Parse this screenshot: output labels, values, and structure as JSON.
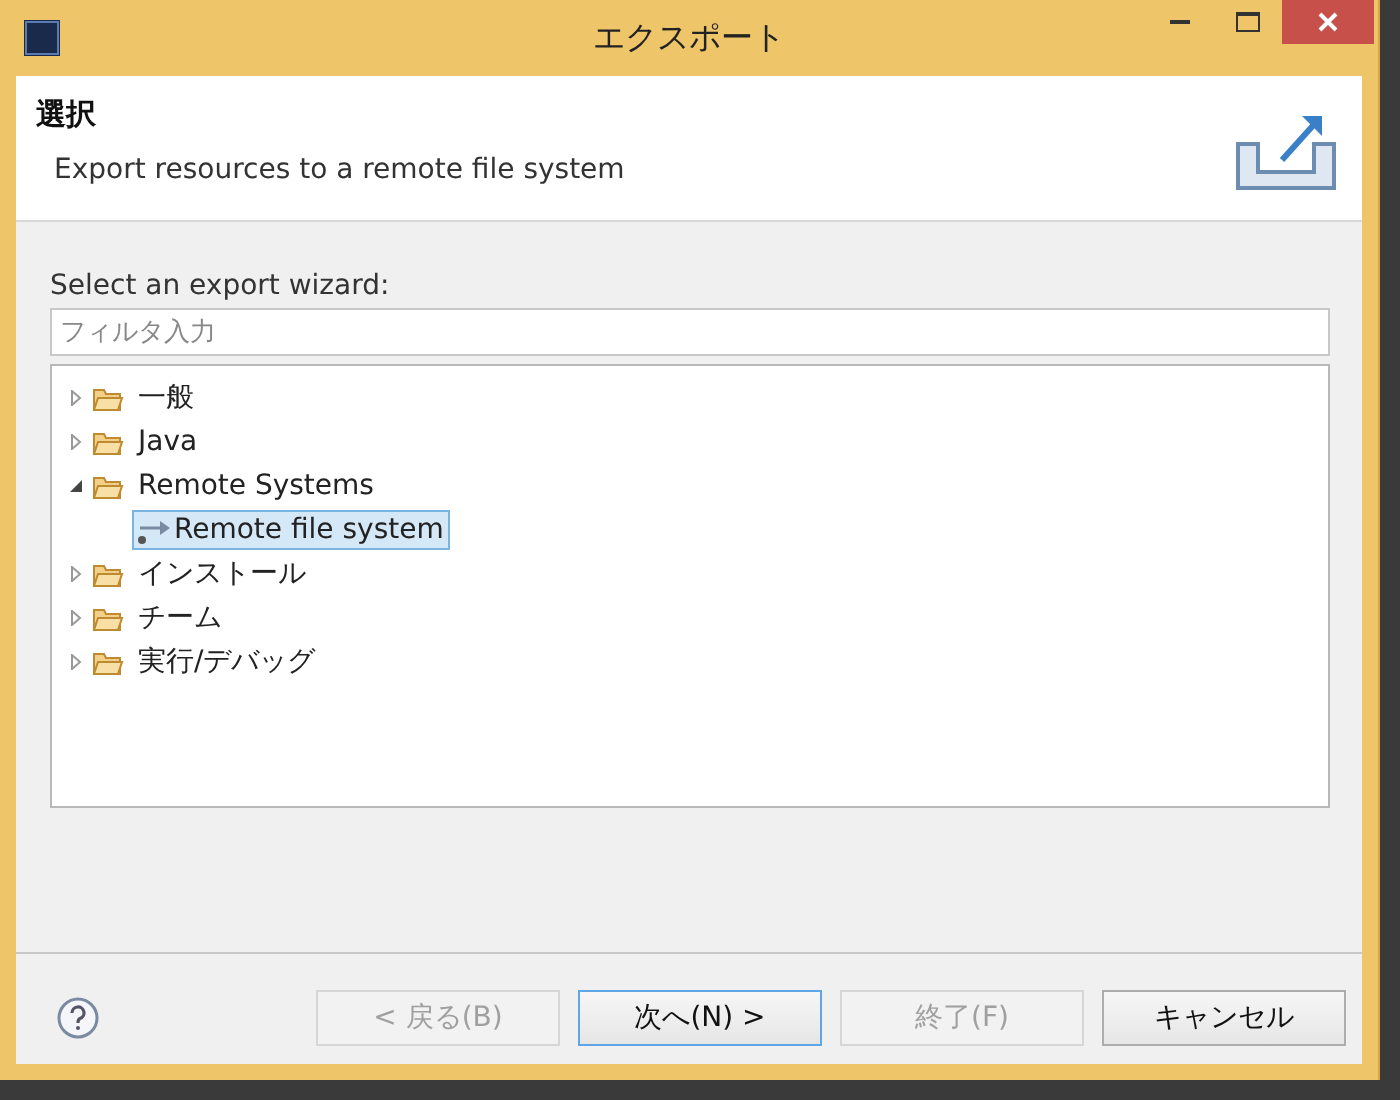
{
  "window": {
    "title": "エクスポート"
  },
  "header": {
    "title": "選択",
    "description": "Export resources to a remote file system"
  },
  "wizard_label": "Select an export wizard:",
  "filter": {
    "placeholder": "フィルタ入力"
  },
  "tree": [
    {
      "label": "一般",
      "kind": "folder",
      "expanded": false,
      "selected": false
    },
    {
      "label": "Java",
      "kind": "folder",
      "expanded": false,
      "selected": false
    },
    {
      "label": "Remote Systems",
      "kind": "folder",
      "expanded": true,
      "selected": false,
      "children": [
        {
          "label": "Remote file system",
          "kind": "wizard",
          "selected": true
        }
      ]
    },
    {
      "label": "インストール",
      "kind": "folder",
      "expanded": false,
      "selected": false
    },
    {
      "label": "チーム",
      "kind": "folder",
      "expanded": false,
      "selected": false
    },
    {
      "label": "実行/デバッグ",
      "kind": "folder",
      "expanded": false,
      "selected": false
    }
  ],
  "buttons": [
    {
      "label": "< 戻る(B)",
      "disabled": true,
      "default": false
    },
    {
      "label": "次へ(N) >",
      "disabled": false,
      "default": true
    },
    {
      "label": "終了(F)",
      "disabled": true,
      "default": false
    },
    {
      "label": "キャンセル",
      "disabled": false,
      "default": false
    }
  ]
}
